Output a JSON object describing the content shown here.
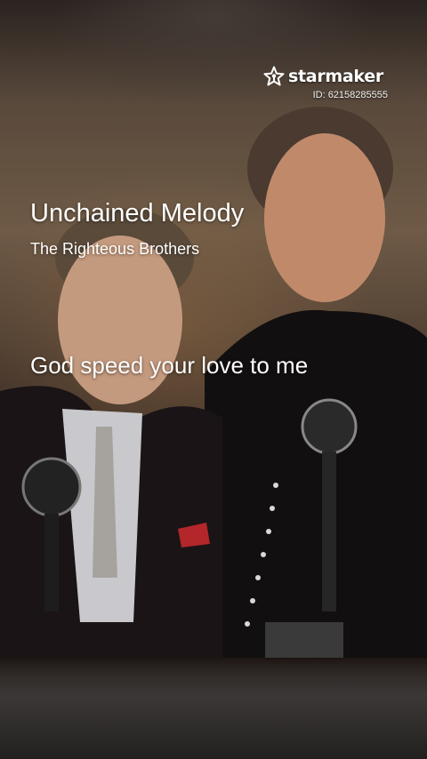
{
  "brand": {
    "name": "starmaker",
    "icon": "starmaker-star-icon"
  },
  "user": {
    "id_label": "ID: 62158285555"
  },
  "song": {
    "title": "Unchained Melody",
    "artist": "The Righteous Brothers"
  },
  "lyrics": {
    "current_line": "God speed your love to me"
  },
  "colors": {
    "text": "#ffffff",
    "background": "#1a1411"
  }
}
